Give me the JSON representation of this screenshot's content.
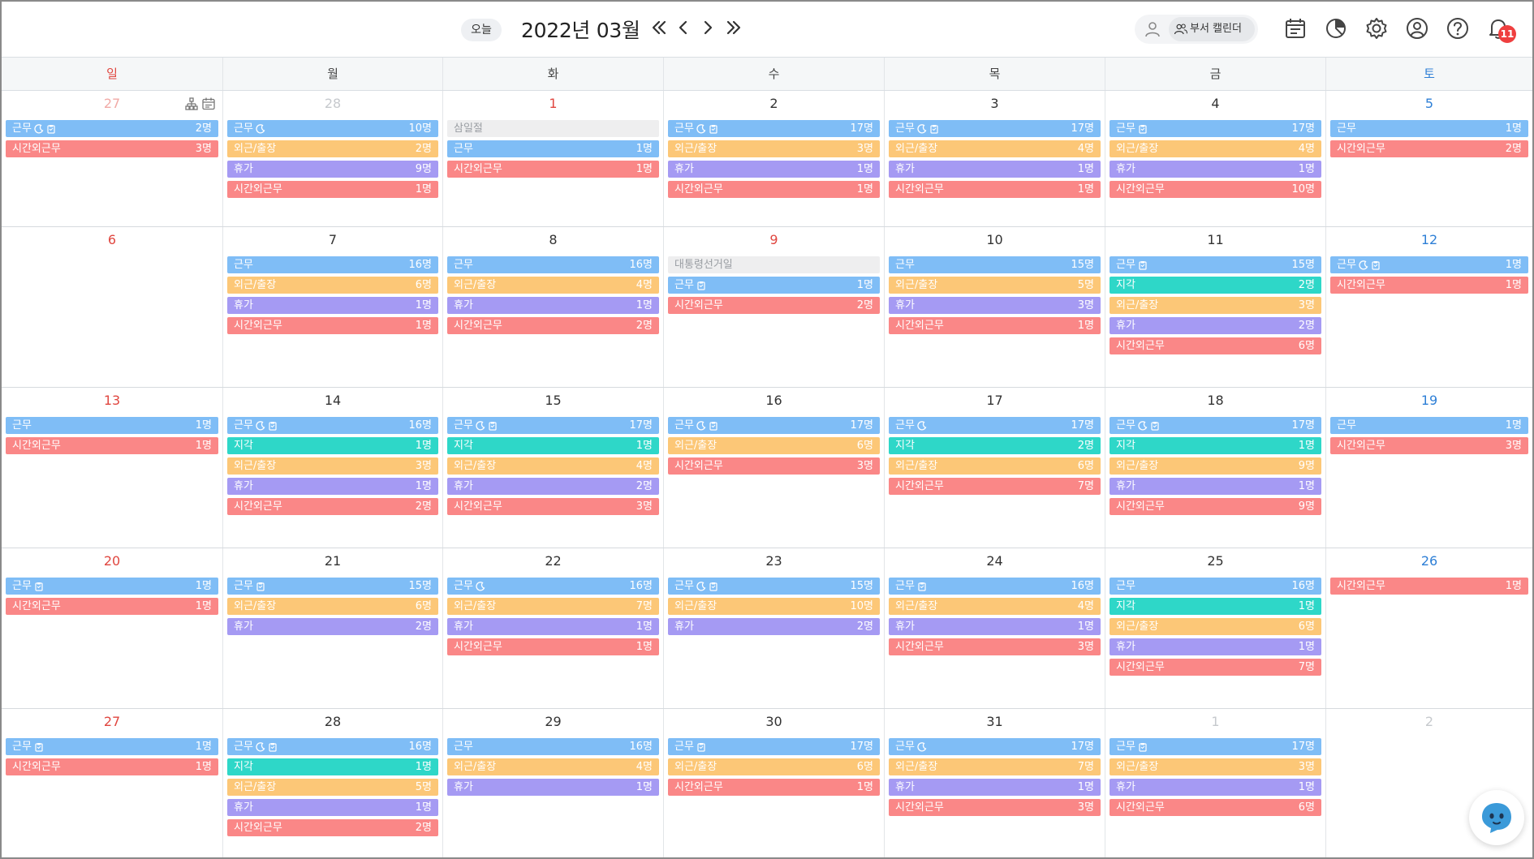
{
  "header": {
    "today_label": "오늘",
    "month_title": "2022년 03월",
    "dept_calendar_label": "부서 캘린더",
    "notification_count": "11"
  },
  "weekdays": [
    "일",
    "월",
    "화",
    "수",
    "목",
    "금",
    "토"
  ],
  "colors": {
    "work": "#7fbdf6",
    "outside": "#fcc777",
    "vacation": "#a59af3",
    "overtime": "#fa8787",
    "late": "#2ed7c8",
    "holiday": "#eeeeef"
  },
  "weeks": [
    [
      {
        "day": "27",
        "other": true,
        "tools": true,
        "events": [
          {
            "type": "work",
            "label": "근무",
            "icons": [
              "moon",
              "clip"
            ],
            "count": "2명"
          },
          {
            "type": "ot",
            "label": "시간외근무",
            "count": "3명"
          }
        ]
      },
      {
        "day": "28",
        "other": true,
        "events": [
          {
            "type": "work",
            "label": "근무",
            "icons": [
              "moon"
            ],
            "count": "10명"
          },
          {
            "type": "out",
            "label": "외근/출장",
            "count": "2명"
          },
          {
            "type": "vac",
            "label": "휴가",
            "count": "9명"
          },
          {
            "type": "ot",
            "label": "시간외근무",
            "count": "1명"
          }
        ]
      },
      {
        "day": "1",
        "holiday": true,
        "events": [
          {
            "type": "holiday",
            "label": "삼일절",
            "count": ""
          },
          {
            "type": "work",
            "label": "근무",
            "count": "1명"
          },
          {
            "type": "ot",
            "label": "시간외근무",
            "count": "1명"
          }
        ]
      },
      {
        "day": "2",
        "events": [
          {
            "type": "work",
            "label": "근무",
            "icons": [
              "moon",
              "clip"
            ],
            "count": "17명"
          },
          {
            "type": "out",
            "label": "외근/출장",
            "count": "3명"
          },
          {
            "type": "vac",
            "label": "휴가",
            "count": "1명"
          },
          {
            "type": "ot",
            "label": "시간외근무",
            "count": "1명"
          }
        ]
      },
      {
        "day": "3",
        "events": [
          {
            "type": "work",
            "label": "근무",
            "icons": [
              "moon",
              "clip"
            ],
            "count": "17명"
          },
          {
            "type": "out",
            "label": "외근/출장",
            "count": "4명"
          },
          {
            "type": "vac",
            "label": "휴가",
            "count": "1명"
          },
          {
            "type": "ot",
            "label": "시간외근무",
            "count": "1명"
          }
        ]
      },
      {
        "day": "4",
        "events": [
          {
            "type": "work",
            "label": "근무",
            "icons": [
              "clip"
            ],
            "count": "17명"
          },
          {
            "type": "out",
            "label": "외근/출장",
            "count": "4명"
          },
          {
            "type": "vac",
            "label": "휴가",
            "count": "1명"
          },
          {
            "type": "ot",
            "label": "시간외근무",
            "count": "10명"
          }
        ]
      },
      {
        "day": "5",
        "events": [
          {
            "type": "work",
            "label": "근무",
            "count": "1명"
          },
          {
            "type": "ot",
            "label": "시간외근무",
            "count": "2명"
          }
        ]
      }
    ],
    [
      {
        "day": "6",
        "events": []
      },
      {
        "day": "7",
        "events": [
          {
            "type": "work",
            "label": "근무",
            "count": "16명"
          },
          {
            "type": "out",
            "label": "외근/출장",
            "count": "6명"
          },
          {
            "type": "vac",
            "label": "휴가",
            "count": "1명"
          },
          {
            "type": "ot",
            "label": "시간외근무",
            "count": "1명"
          }
        ]
      },
      {
        "day": "8",
        "events": [
          {
            "type": "work",
            "label": "근무",
            "count": "16명"
          },
          {
            "type": "out",
            "label": "외근/출장",
            "count": "4명"
          },
          {
            "type": "vac",
            "label": "휴가",
            "count": "1명"
          },
          {
            "type": "ot",
            "label": "시간외근무",
            "count": "2명"
          }
        ]
      },
      {
        "day": "9",
        "holiday": true,
        "events": [
          {
            "type": "holiday",
            "label": "대통령선거일",
            "count": ""
          },
          {
            "type": "work",
            "label": "근무",
            "icons": [
              "clip"
            ],
            "count": "1명"
          },
          {
            "type": "ot",
            "label": "시간외근무",
            "count": "2명"
          }
        ]
      },
      {
        "day": "10",
        "events": [
          {
            "type": "work",
            "label": "근무",
            "count": "15명"
          },
          {
            "type": "out",
            "label": "외근/출장",
            "count": "5명"
          },
          {
            "type": "vac",
            "label": "휴가",
            "count": "3명"
          },
          {
            "type": "ot",
            "label": "시간외근무",
            "count": "1명"
          }
        ]
      },
      {
        "day": "11",
        "events": [
          {
            "type": "work",
            "label": "근무",
            "icons": [
              "clip"
            ],
            "count": "15명"
          },
          {
            "type": "late",
            "label": "지각",
            "count": "2명"
          },
          {
            "type": "out",
            "label": "외근/출장",
            "count": "3명"
          },
          {
            "type": "vac",
            "label": "휴가",
            "count": "2명"
          },
          {
            "type": "ot",
            "label": "시간외근무",
            "count": "6명"
          }
        ]
      },
      {
        "day": "12",
        "events": [
          {
            "type": "work",
            "label": "근무",
            "icons": [
              "moon",
              "clip"
            ],
            "count": "1명"
          },
          {
            "type": "ot",
            "label": "시간외근무",
            "count": "1명"
          }
        ]
      }
    ],
    [
      {
        "day": "13",
        "events": [
          {
            "type": "work",
            "label": "근무",
            "count": "1명"
          },
          {
            "type": "ot",
            "label": "시간외근무",
            "count": "1명"
          }
        ]
      },
      {
        "day": "14",
        "events": [
          {
            "type": "work",
            "label": "근무",
            "icons": [
              "moon",
              "clip"
            ],
            "count": "16명"
          },
          {
            "type": "late",
            "label": "지각",
            "count": "1명"
          },
          {
            "type": "out",
            "label": "외근/출장",
            "count": "3명"
          },
          {
            "type": "vac",
            "label": "휴가",
            "count": "1명"
          },
          {
            "type": "ot",
            "label": "시간외근무",
            "count": "2명"
          }
        ]
      },
      {
        "day": "15",
        "events": [
          {
            "type": "work",
            "label": "근무",
            "icons": [
              "moon",
              "clip"
            ],
            "count": "17명"
          },
          {
            "type": "late",
            "label": "지각",
            "count": "1명"
          },
          {
            "type": "out",
            "label": "외근/출장",
            "count": "4명"
          },
          {
            "type": "vac",
            "label": "휴가",
            "count": "2명"
          },
          {
            "type": "ot",
            "label": "시간외근무",
            "count": "3명"
          }
        ]
      },
      {
        "day": "16",
        "events": [
          {
            "type": "work",
            "label": "근무",
            "icons": [
              "moon",
              "clip"
            ],
            "count": "17명"
          },
          {
            "type": "out",
            "label": "외근/출장",
            "count": "6명"
          },
          {
            "type": "ot",
            "label": "시간외근무",
            "count": "3명"
          }
        ]
      },
      {
        "day": "17",
        "events": [
          {
            "type": "work",
            "label": "근무",
            "icons": [
              "moon"
            ],
            "count": "17명"
          },
          {
            "type": "late",
            "label": "지각",
            "count": "2명"
          },
          {
            "type": "out",
            "label": "외근/출장",
            "count": "6명"
          },
          {
            "type": "ot",
            "label": "시간외근무",
            "count": "7명"
          }
        ]
      },
      {
        "day": "18",
        "events": [
          {
            "type": "work",
            "label": "근무",
            "icons": [
              "moon",
              "clip"
            ],
            "count": "17명"
          },
          {
            "type": "late",
            "label": "지각",
            "count": "1명"
          },
          {
            "type": "out",
            "label": "외근/출장",
            "count": "9명"
          },
          {
            "type": "vac",
            "label": "휴가",
            "count": "1명"
          },
          {
            "type": "ot",
            "label": "시간외근무",
            "count": "9명"
          }
        ]
      },
      {
        "day": "19",
        "events": [
          {
            "type": "work",
            "label": "근무",
            "count": "1명"
          },
          {
            "type": "ot",
            "label": "시간외근무",
            "count": "3명"
          }
        ]
      }
    ],
    [
      {
        "day": "20",
        "events": [
          {
            "type": "work",
            "label": "근무",
            "icons": [
              "clip"
            ],
            "count": "1명"
          },
          {
            "type": "ot",
            "label": "시간외근무",
            "count": "1명"
          }
        ]
      },
      {
        "day": "21",
        "events": [
          {
            "type": "work",
            "label": "근무",
            "icons": [
              "clip"
            ],
            "count": "15명"
          },
          {
            "type": "out",
            "label": "외근/출장",
            "count": "6명"
          },
          {
            "type": "vac",
            "label": "휴가",
            "count": "2명"
          }
        ]
      },
      {
        "day": "22",
        "events": [
          {
            "type": "work",
            "label": "근무",
            "icons": [
              "moon"
            ],
            "count": "16명"
          },
          {
            "type": "out",
            "label": "외근/출장",
            "count": "7명"
          },
          {
            "type": "vac",
            "label": "휴가",
            "count": "1명"
          },
          {
            "type": "ot",
            "label": "시간외근무",
            "count": "1명"
          }
        ]
      },
      {
        "day": "23",
        "events": [
          {
            "type": "work",
            "label": "근무",
            "icons": [
              "moon",
              "clip"
            ],
            "count": "15명"
          },
          {
            "type": "out",
            "label": "외근/출장",
            "count": "10명"
          },
          {
            "type": "vac",
            "label": "휴가",
            "count": "2명"
          }
        ]
      },
      {
        "day": "24",
        "events": [
          {
            "type": "work",
            "label": "근무",
            "icons": [
              "clip"
            ],
            "count": "16명"
          },
          {
            "type": "out",
            "label": "외근/출장",
            "count": "4명"
          },
          {
            "type": "vac",
            "label": "휴가",
            "count": "1명"
          },
          {
            "type": "ot",
            "label": "시간외근무",
            "count": "3명"
          }
        ]
      },
      {
        "day": "25",
        "events": [
          {
            "type": "work",
            "label": "근무",
            "count": "16명"
          },
          {
            "type": "late",
            "label": "지각",
            "count": "1명"
          },
          {
            "type": "out",
            "label": "외근/출장",
            "count": "6명"
          },
          {
            "type": "vac",
            "label": "휴가",
            "count": "1명"
          },
          {
            "type": "ot",
            "label": "시간외근무",
            "count": "7명"
          }
        ]
      },
      {
        "day": "26",
        "events": [
          {
            "type": "ot",
            "label": "시간외근무",
            "count": "1명"
          }
        ]
      }
    ],
    [
      {
        "day": "27",
        "events": [
          {
            "type": "work",
            "label": "근무",
            "icons": [
              "clip"
            ],
            "count": "1명"
          },
          {
            "type": "ot",
            "label": "시간외근무",
            "count": "1명"
          }
        ]
      },
      {
        "day": "28",
        "events": [
          {
            "type": "work",
            "label": "근무",
            "icons": [
              "moon",
              "clip"
            ],
            "count": "16명"
          },
          {
            "type": "late",
            "label": "지각",
            "count": "1명"
          },
          {
            "type": "out",
            "label": "외근/출장",
            "count": "5명"
          },
          {
            "type": "vac",
            "label": "휴가",
            "count": "1명"
          },
          {
            "type": "ot",
            "label": "시간외근무",
            "count": "2명"
          }
        ]
      },
      {
        "day": "29",
        "events": [
          {
            "type": "work",
            "label": "근무",
            "count": "16명"
          },
          {
            "type": "out",
            "label": "외근/출장",
            "count": "4명"
          },
          {
            "type": "vac",
            "label": "휴가",
            "count": "1명"
          }
        ]
      },
      {
        "day": "30",
        "events": [
          {
            "type": "work",
            "label": "근무",
            "icons": [
              "clip"
            ],
            "count": "17명"
          },
          {
            "type": "out",
            "label": "외근/출장",
            "count": "6명"
          },
          {
            "type": "ot",
            "label": "시간외근무",
            "count": "1명"
          }
        ]
      },
      {
        "day": "31",
        "events": [
          {
            "type": "work",
            "label": "근무",
            "icons": [
              "moon"
            ],
            "count": "17명"
          },
          {
            "type": "out",
            "label": "외근/출장",
            "count": "7명"
          },
          {
            "type": "vac",
            "label": "휴가",
            "count": "1명"
          },
          {
            "type": "ot",
            "label": "시간외근무",
            "count": "3명"
          }
        ]
      },
      {
        "day": "1",
        "other": true,
        "events": [
          {
            "type": "work",
            "label": "근무",
            "icons": [
              "clip"
            ],
            "count": "17명"
          },
          {
            "type": "out",
            "label": "외근/출장",
            "count": "3명"
          },
          {
            "type": "vac",
            "label": "휴가",
            "count": "1명"
          },
          {
            "type": "ot",
            "label": "시간외근무",
            "count": "6명"
          }
        ]
      },
      {
        "day": "2",
        "other": true,
        "events": []
      }
    ]
  ]
}
